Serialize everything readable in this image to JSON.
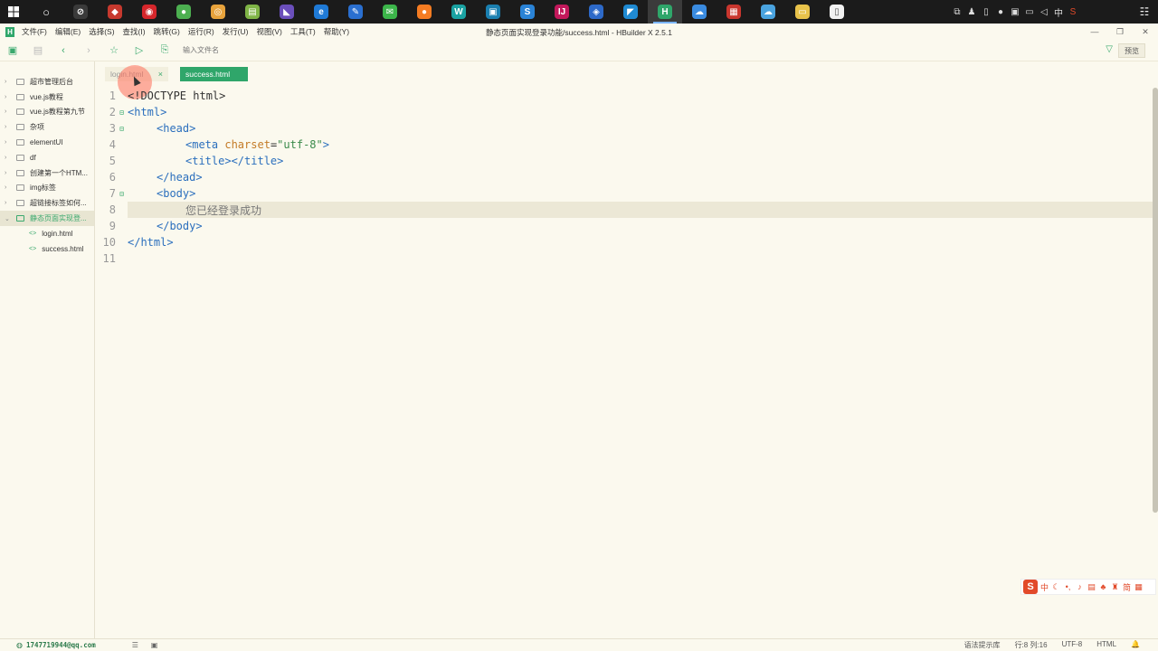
{
  "taskbar": {
    "apps": [
      {
        "icon": "circle-search-icon",
        "color": "#1b1b1b",
        "glyph": "○"
      },
      {
        "icon": "overwatch-icon",
        "color": "#3a3a3a",
        "glyph": "⊘"
      },
      {
        "icon": "app-red-icon",
        "color": "#c7392e",
        "glyph": "◆"
      },
      {
        "icon": "netease-music-icon",
        "color": "#d6262b",
        "glyph": "◉"
      },
      {
        "icon": "green-app-icon",
        "color": "#4caf50",
        "glyph": "●"
      },
      {
        "icon": "chrome-icon",
        "color": "#e8a33c",
        "glyph": "◎"
      },
      {
        "icon": "notepad-green-icon",
        "color": "#7fb446",
        "glyph": "▤"
      },
      {
        "icon": "visual-studio-icon",
        "color": "#6b4fbb",
        "glyph": "◣"
      },
      {
        "icon": "edge-icon",
        "color": "#1f7ad6",
        "glyph": "e"
      },
      {
        "icon": "pen-app-icon",
        "color": "#2a6fd0",
        "glyph": "✎"
      },
      {
        "icon": "wechat-icon",
        "color": "#3cb54a",
        "glyph": "✉"
      },
      {
        "icon": "firefox-icon",
        "color": "#f57c22",
        "glyph": "●"
      },
      {
        "icon": "webstorm-icon",
        "color": "#1aa2a2",
        "glyph": "W"
      },
      {
        "icon": "terminal-icon",
        "color": "#1a7fb0",
        "glyph": "▣"
      },
      {
        "icon": "sogou-icon",
        "color": "#2a83d6",
        "glyph": "S"
      },
      {
        "icon": "intellij-icon",
        "color": "#c2185b",
        "glyph": "IJ"
      },
      {
        "icon": "eclipse-icon",
        "color": "#2d69c8",
        "glyph": "◈"
      },
      {
        "icon": "vscode-icon",
        "color": "#1f8ad2",
        "glyph": "◤"
      },
      {
        "icon": "hbuilder-icon",
        "color": "#2fa66a",
        "glyph": "H"
      },
      {
        "icon": "cloud-app-icon",
        "color": "#3a8be0",
        "glyph": "☁"
      },
      {
        "icon": "photo-app-icon",
        "color": "#c9362e",
        "glyph": "▦"
      },
      {
        "icon": "weather-icon",
        "color": "#4aa3df",
        "glyph": "☁"
      },
      {
        "icon": "file-explorer-icon",
        "color": "#e8c24a",
        "glyph": "▭"
      },
      {
        "icon": "document-icon",
        "color": "#f2f2f2",
        "glyph": "▯"
      }
    ],
    "tray_lang": "中"
  },
  "menubar": {
    "items": [
      "文件(F)",
      "编辑(E)",
      "选择(S)",
      "查找(I)",
      "跳转(G)",
      "运行(R)",
      "发行(U)",
      "视图(V)",
      "工具(T)",
      "帮助(Y)"
    ],
    "title": "静态页面实现登录功能/success.html - HBuilder X 2.5.1"
  },
  "toolbar": {
    "search_placeholder": "输入文件名",
    "preview_label": "预览"
  },
  "sidebar": {
    "projects": [
      "超市管理后台",
      "vue.js教程",
      "vue.js教程第九节",
      "杂项",
      "elementUI",
      "df",
      "创建第一个HTM...",
      "img标签",
      "超链接标签如何...",
      "静态页面实现登..."
    ],
    "files": [
      "login.html",
      "success.html"
    ]
  },
  "tabs": {
    "inactive": "login.html",
    "active": "success.html"
  },
  "editor": {
    "line_numbers": [
      "1",
      "2",
      "3",
      "4",
      "5",
      "6",
      "7",
      "8",
      "9",
      "10",
      "11"
    ],
    "lines": {
      "l1": "<!DOCTYPE html>",
      "l2": "<html>",
      "l3": "<head>",
      "l4_tag": "<meta",
      "l4_attr": "charset",
      "l4_eq": "=",
      "l4_val": "\"utf-8\"",
      "l4_end": ">",
      "l5": "<title></title>",
      "l6": "</head>",
      "l7": "<body>",
      "l8": "您已经登录成功",
      "l9": "</body>",
      "l10": "</html>"
    }
  },
  "statusbar": {
    "user": "1747719944@qq.com",
    "syntax": "语法提示库",
    "position": "行:8  列:16",
    "encoding": "UTF-8",
    "language": "HTML"
  },
  "ime": {
    "logo": "S",
    "lang": "中"
  }
}
